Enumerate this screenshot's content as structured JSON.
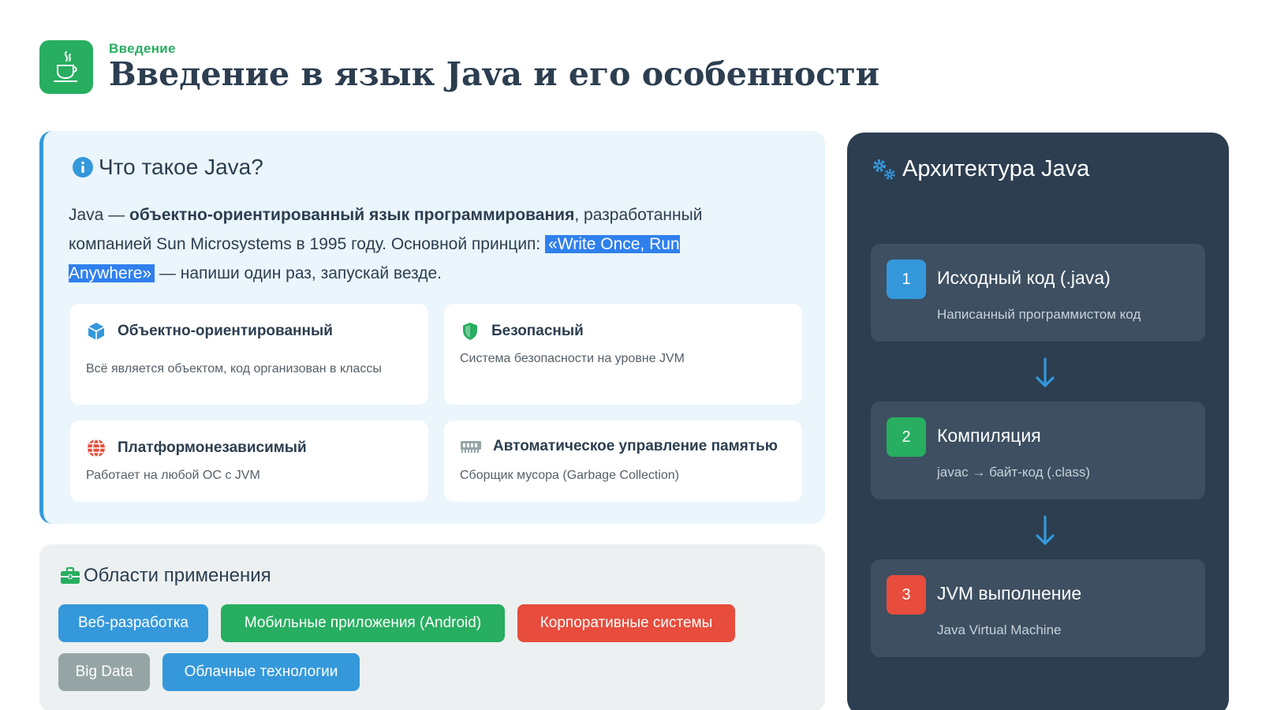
{
  "header": {
    "kicker": "Введение",
    "title": "Введение в язык Java и его особенности",
    "logo_icon": "java-cup-icon"
  },
  "intro": {
    "heading": "Что такое Java?",
    "heading_icon": "info-icon",
    "text_prefix": "Java — ",
    "text_bold": "объектно-ориентированный язык программирования",
    "text_middle": ", разработанный компанией Sun Microsystems в 1995 году. Основной принцип: ",
    "text_highlight": "«Write Once, Run Anywhere»",
    "text_suffix": " — напиши один раз, запускай везде.",
    "features": [
      {
        "icon": "cube-icon",
        "title": "Объектно-ориентированный",
        "desc": "Всё является объектом, код организован в классы"
      },
      {
        "icon": "shield-icon",
        "title": "Безопасный",
        "desc": "Система безопасности на уровне JVM"
      },
      {
        "icon": "globe-icon",
        "title": "Платформонезависимый",
        "desc": "Работает на любой ОС с JVM"
      },
      {
        "icon": "memory-icon",
        "title": "Автоматическое управление памятью",
        "desc": "Сборщик мусора (Garbage Collection)"
      }
    ]
  },
  "applications": {
    "heading": "Области применения",
    "heading_icon": "briefcase-icon",
    "tags": [
      "Веб-разработка",
      "Мобильные приложения (Android)",
      "Корпоративные системы",
      "Big Data",
      "Облачные технологии"
    ]
  },
  "architecture": {
    "heading": "Архитектура Java",
    "heading_icon": "gears-icon",
    "steps": [
      {
        "number": "1",
        "title": "Исходный код (.java)",
        "desc": "Написанный программистом код"
      },
      {
        "number": "2",
        "title": "Компиляция",
        "desc": "javac → байт-код (.class)"
      },
      {
        "number": "3",
        "title": "JVM выполнение",
        "desc": "Java Virtual Machine"
      }
    ]
  },
  "colors": {
    "green": "#27ae60",
    "blue": "#3498db",
    "red": "#e74c3c",
    "gray": "#95a5a6",
    "dark": "#2c3e50",
    "highlight": "#2f80ed"
  }
}
